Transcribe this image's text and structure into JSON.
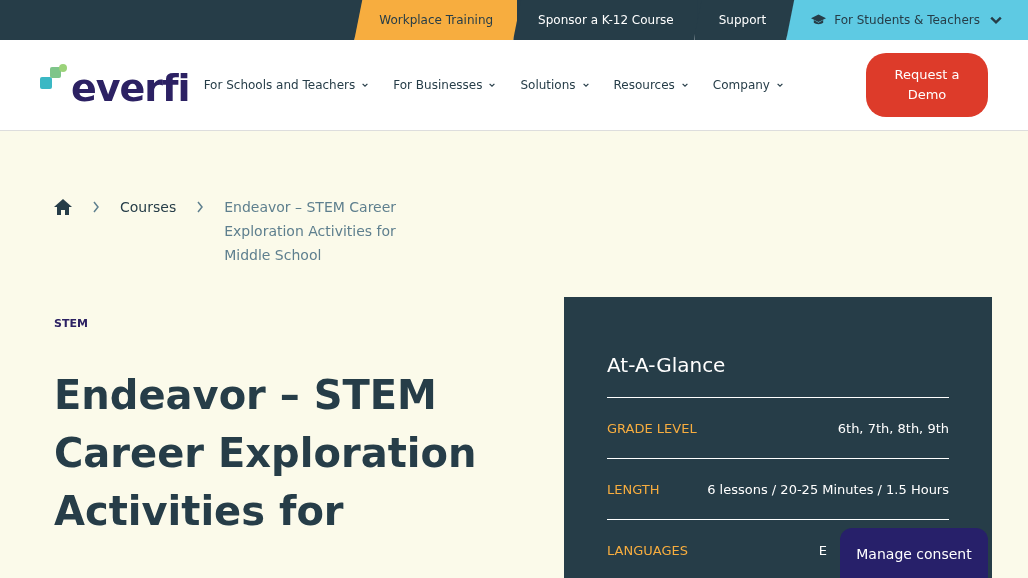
{
  "top_bar": {
    "tabs": [
      {
        "label": "Workplace Training",
        "color": "#f7ad3f",
        "kind": "plain"
      },
      {
        "label": "Sponsor a K-12 Course",
        "color": "#263d48",
        "kind": "plain"
      },
      {
        "label": "Support",
        "color": "#263d48",
        "kind": "plain"
      },
      {
        "label": "For Students & Teachers",
        "color": "#5ecae3",
        "kind": "dropdown"
      }
    ]
  },
  "header": {
    "logo": "everfi",
    "nav": [
      "For Schools and Teachers",
      "For Businesses",
      "Solutions",
      "Resources",
      "Company"
    ],
    "cta": "Request a Demo"
  },
  "breadcrumb": [
    "Courses",
    "Endeavor – STEM Career Exploration Activities for Middle School"
  ],
  "hero": {
    "category": "STEM",
    "title": "Endeavor – STEM Career Exploration Activities for"
  },
  "glance": {
    "title": "At-A-Glance",
    "rows": [
      {
        "label": "GRADE LEVEL",
        "value": "6th, 7th, 8th, 9th"
      },
      {
        "label": "LENGTH",
        "value": "6 lessons / 20-25 Minutes / 1.5 Hours"
      },
      {
        "label": "LANGUAGES",
        "value": "E"
      }
    ]
  },
  "consent": "Manage consent"
}
